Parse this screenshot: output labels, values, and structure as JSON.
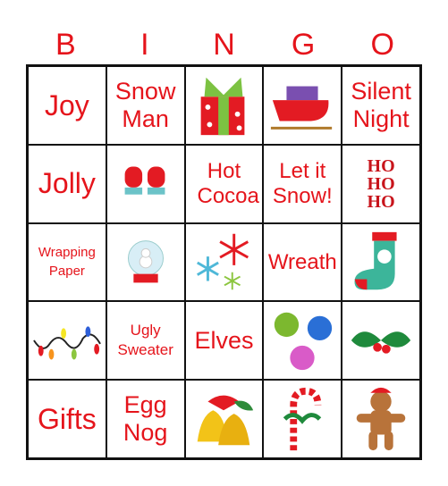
{
  "header": {
    "letters": [
      "B",
      "I",
      "N",
      "G",
      "O"
    ]
  },
  "colors": {
    "accent": "#e5141b",
    "border": "#111111"
  },
  "cells": [
    {
      "text": "Joy"
    },
    {
      "text": "Snow Man"
    },
    {
      "icon": "gift-icon"
    },
    {
      "icon": "sleigh-icon"
    },
    {
      "text": "Silent Night"
    },
    {
      "text": "Jolly"
    },
    {
      "icon": "mittens-icon"
    },
    {
      "text": "Hot Cocoa"
    },
    {
      "text": "Let it Snow!"
    },
    {
      "icon": "ho-ho-ho-icon",
      "label": "HO HO HO"
    },
    {
      "text": "Wrapping Paper"
    },
    {
      "icon": "snow-globe-icon"
    },
    {
      "icon": "snowflakes-icon"
    },
    {
      "text": "Wreath"
    },
    {
      "icon": "stocking-icon"
    },
    {
      "icon": "lights-icon"
    },
    {
      "text": "Ugly Sweater"
    },
    {
      "text": "Elves"
    },
    {
      "icon": "ornaments-icon"
    },
    {
      "icon": "holly-icon"
    },
    {
      "text": "Gifts"
    },
    {
      "text": "Egg Nog"
    },
    {
      "icon": "bells-icon"
    },
    {
      "icon": "candy-cane-icon"
    },
    {
      "icon": "gingerbread-man-icon"
    }
  ]
}
